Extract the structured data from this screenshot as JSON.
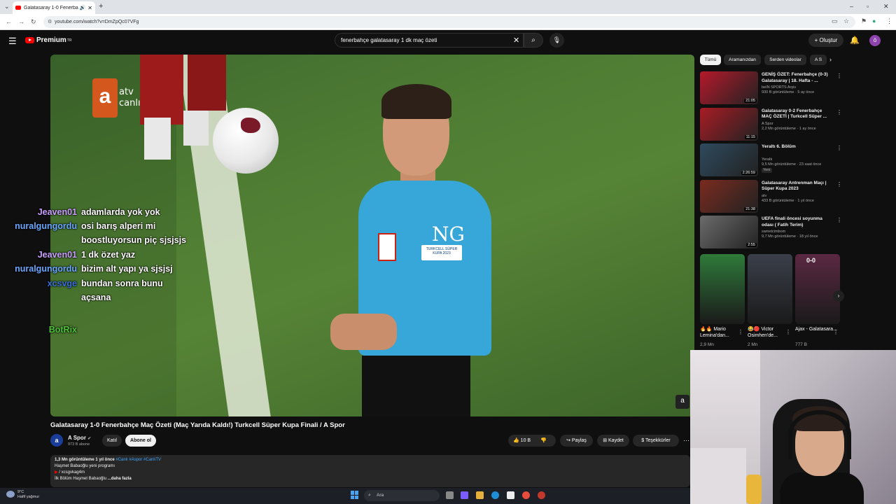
{
  "browser": {
    "tab_title": "Galatasaray 1-0 Fenerbahçe",
    "url": "youtube.com/watch?v=DmZpQc07VFg"
  },
  "youtube": {
    "logo_text": "Premium",
    "logo_sup": "TR",
    "search_query": "fenerbahçe galatasaray 1 dk maç özeti",
    "create_label": "Oluştur",
    "avatar_letter": "ö"
  },
  "player": {
    "broadcaster": "atv",
    "broadcaster_sub": "canlı",
    "shirt_logo": "NG",
    "patch_text": "TURKCELL SÜPER KUPA 2023"
  },
  "chat": [
    {
      "user": "Jeaven01",
      "msg": "adamlarda yok yok",
      "color": "#c9a0ff"
    },
    {
      "user": "nuralgungordu",
      "msg": "osi barış alperi mi",
      "color": "#6aa7ff"
    },
    {
      "user": "",
      "msg": "boostluyorsun piç sjsjsjs",
      "color": "#fff"
    },
    {
      "user": "Jeaven01",
      "msg": "1 dk özet yaz",
      "color": "#c9a0ff"
    },
    {
      "user": "nuralgungordu",
      "msg": "bizim alt yapı ya sjsjsj",
      "color": "#6aa7ff"
    },
    {
      "user": "xcsvge",
      "msg": "bundan sonra bunu",
      "color": "#3a6fd8"
    },
    {
      "user": "",
      "msg": "açsana",
      "color": "#fff"
    },
    {
      "user": "BotRix",
      "msg": "",
      "color": "#4fc23a"
    }
  ],
  "video": {
    "title": "Galatasaray 1-0 Fenerbahçe Maç Özeti (Maç Yarıda Kaldı!) Turkcell Süper Kupa Finali / A Spor",
    "channel": "A Spor",
    "subscribers": "973 B abone",
    "join_label": "Katıl",
    "subscribe_label": "Abone ol",
    "likes": "10 B",
    "share_label": "Paylaş",
    "save_label": "Kaydet",
    "thanks_label": "Teşekkürler",
    "views": "1,3 Mn görüntüleme  1 yıl önce",
    "tags": "#Canlı #Aspor #CanlıTV",
    "desc_line1": "Haşmet Babaoğlu yeni programı",
    "desc_line2": "/ xcsgvkag4m",
    "desc_line3": "İlk Bölüm Haşmet Babaoğlu",
    "more_label": "...daha fazla"
  },
  "sidebar": {
    "chips": [
      "Tümü",
      "Aramanızdan",
      "Serden videolar",
      "A S"
    ],
    "videos": [
      {
        "title": "GENİŞ ÖZET: Fenerbahçe (0-3) Galatasaray | 18. Hafta - ...",
        "channel": "beIN SPORTS Arşiv",
        "meta": "930 B görüntüleme · 5 ay önce",
        "duration": "21:05",
        "thumb": "#b5192b"
      },
      {
        "title": "Galatasaray 0-2 Fenerbahçe MAÇ ÖZETİ | Turkcell Süper ...",
        "channel": "A Spor",
        "meta": "2,2 Mn görüntüleme · 1 ay önce",
        "duration": "11:15",
        "thumb": "#a81c25"
      },
      {
        "title": "Yeraltı 6. Bölüm",
        "channel": "Yeraltı",
        "meta": "9,5 Mn görüntüleme · 23 saat önce",
        "duration": "2:26:59",
        "badge": "Yeni",
        "thumb": "#2e4a5e"
      },
      {
        "title": "Galatasaray Antrenman Maçı | Süper Kupa 2023",
        "channel": "atv",
        "meta": "433 B görüntüleme · 1 yıl önce",
        "duration": "21:38",
        "thumb": "#7a2b1f"
      },
      {
        "title": "UEFA finali öncesi soyunma odası ( Fatih Terim)",
        "channel": "sametcimbom",
        "meta": "9,7 Mn görüntüleme · 18 yıl önce",
        "duration": "2:55",
        "thumb": "#6b6b6b"
      }
    ],
    "shorts": [
      {
        "title": "🔥🔥 Mario Lemina'dan...",
        "views": "2,9 Mn",
        "thumb": "#2f7a3a"
      },
      {
        "title": "😂🔴 Victor Osimhen'de...",
        "views": "2 Mn",
        "thumb": "#3a3f4a"
      },
      {
        "title": "Ajax - Galatasara...",
        "views": "777 B",
        "score": "0-0",
        "thumb": "#5a2842"
      }
    ]
  },
  "taskbar": {
    "temp": "9°C",
    "weather": "Hafif yağmur",
    "search": "Ara"
  }
}
